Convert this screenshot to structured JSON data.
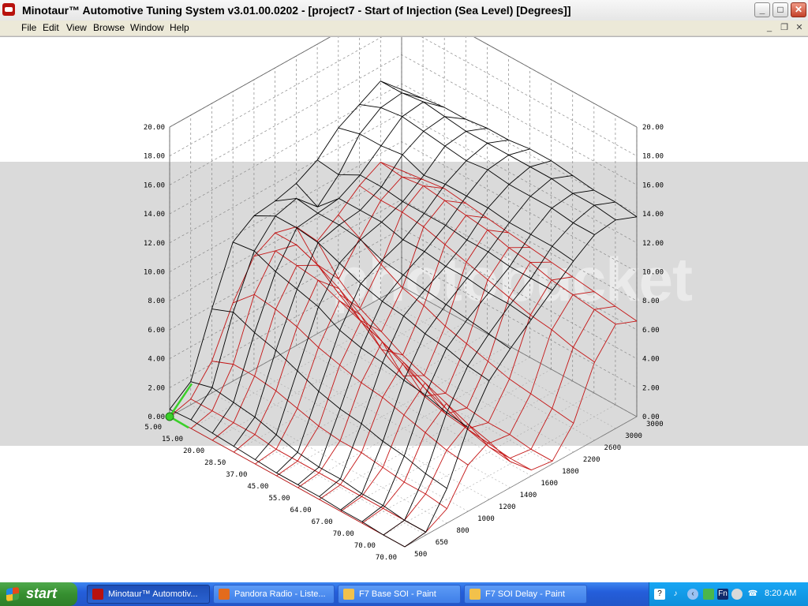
{
  "window": {
    "title": "Minotaur™ Automotive Tuning System  v3.01.00.0202 - [project7 - Start of Injection (Sea Level) [Degrees]]",
    "controls": {
      "minimize": "_",
      "maximize": "□",
      "close": "✕"
    }
  },
  "menubar": {
    "items": [
      "File",
      "Edit",
      "View",
      "Browse",
      "Window",
      "Help"
    ],
    "mdi_controls": {
      "minimize": "_",
      "restore": "❐",
      "close": "✕"
    }
  },
  "watermark": {
    "text": "photobucket"
  },
  "chart_data": {
    "type": "surface-3d",
    "axes": {
      "z_ticks": [
        "0.00",
        "2.00",
        "4.00",
        "6.00",
        "8.00",
        "10.00",
        "12.00",
        "14.00",
        "16.00",
        "18.00",
        "20.00"
      ],
      "load_ticks": [
        "5.00",
        "15.00",
        "20.00",
        "28.50",
        "37.00",
        "45.00",
        "55.00",
        "64.00",
        "67.00",
        "70.00",
        "70.00",
        "70.00"
      ],
      "rpm_ticks": [
        "500",
        "650",
        "800",
        "1000",
        "1200",
        "1400",
        "1600",
        "1800",
        "2200",
        "2600",
        "3000",
        "3000"
      ]
    },
    "series": [
      {
        "color": "#000000",
        "rows": [
          [
            0.5,
            1.6,
            5.8,
            9.6,
            10.6,
            10.8,
            11.2,
            12.0,
            13.4,
            14.2,
            15.0,
            13.6
          ],
          [
            0.6,
            2.0,
            6.4,
            9.8,
            11.4,
            11.8,
            10.4,
            11.8,
            13.8,
            14.8,
            15.0,
            13.8
          ],
          [
            0.5,
            1.8,
            5.8,
            9.2,
            11.4,
            11.6,
            11.8,
            12.6,
            13.8,
            15.0,
            15.2,
            14.0
          ],
          [
            0.4,
            1.6,
            5.4,
            8.8,
            11.2,
            11.6,
            11.8,
            12.6,
            14.0,
            14.8,
            15.0,
            14.0
          ],
          [
            0.3,
            1.2,
            4.8,
            8.4,
            10.6,
            11.4,
            11.8,
            12.4,
            13.4,
            14.6,
            14.8,
            14.2
          ],
          [
            0.2,
            0.8,
            4.2,
            7.6,
            10.0,
            10.8,
            11.4,
            12.4,
            13.6,
            14.4,
            14.8,
            14.2
          ],
          [
            0.2,
            0.6,
            3.8,
            7.2,
            9.6,
            10.6,
            11.4,
            12.4,
            13.6,
            14.6,
            14.8,
            14.4
          ],
          [
            0.2,
            0.6,
            3.6,
            7.0,
            9.4,
            10.4,
            11.2,
            12.2,
            13.6,
            14.4,
            14.8,
            14.4
          ],
          [
            0.1,
            0.4,
            3.2,
            6.6,
            9.0,
            10.2,
            11.2,
            12.2,
            13.4,
            14.4,
            14.8,
            14.2
          ],
          [
            0.1,
            0.4,
            3.0,
            6.4,
            8.8,
            10.0,
            11.0,
            12.0,
            13.4,
            14.4,
            14.6,
            14.0
          ],
          [
            0.0,
            0.2,
            2.6,
            6.0,
            8.4,
            9.8,
            11.0,
            12.0,
            13.4,
            14.2,
            14.6,
            14.0
          ],
          [
            0.0,
            0.2,
            2.4,
            5.8,
            8.2,
            9.6,
            10.8,
            12.0,
            13.2,
            14.2,
            14.4,
            13.8
          ]
        ]
      },
      {
        "color": "#c41414",
        "rows": [
          [
            0.0,
            0.4,
            2.2,
            5.4,
            7.8,
            8.6,
            8.2,
            6.4,
            7.4,
            8.6,
            9.4,
            8.0
          ],
          [
            0.0,
            0.4,
            2.8,
            6.8,
            9.0,
            8.6,
            6.4,
            4.6,
            6.6,
            8.4,
            9.2,
            8.2
          ],
          [
            0.0,
            0.4,
            2.8,
            6.6,
            8.8,
            8.0,
            5.2,
            3.4,
            5.6,
            8.4,
            9.4,
            8.4
          ],
          [
            0.0,
            0.4,
            2.6,
            6.2,
            8.6,
            7.2,
            4.2,
            2.6,
            4.8,
            8.2,
            9.2,
            8.2
          ],
          [
            0.0,
            0.2,
            2.2,
            5.6,
            8.0,
            6.2,
            3.0,
            1.8,
            4.4,
            7.8,
            9.0,
            8.0
          ],
          [
            0.0,
            0.2,
            1.8,
            5.2,
            7.4,
            5.2,
            2.0,
            1.2,
            3.8,
            7.4,
            8.8,
            7.8
          ],
          [
            0.0,
            0.2,
            1.6,
            4.8,
            6.8,
            4.4,
            1.4,
            0.8,
            3.4,
            7.0,
            8.4,
            7.6
          ],
          [
            0.0,
            0.2,
            1.6,
            4.6,
            6.2,
            3.6,
            1.0,
            0.6,
            3.0,
            6.6,
            8.2,
            7.4
          ],
          [
            0.0,
            0.2,
            1.4,
            4.2,
            5.6,
            3.0,
            0.8,
            0.4,
            2.6,
            6.2,
            7.8,
            7.2
          ],
          [
            0.0,
            0.2,
            1.2,
            3.8,
            5.0,
            2.4,
            0.6,
            0.4,
            2.4,
            6.0,
            7.6,
            7.0
          ],
          [
            0.0,
            0.2,
            1.2,
            3.4,
            4.4,
            2.0,
            0.4,
            0.2,
            2.2,
            5.6,
            7.4,
            6.8
          ],
          [
            0.0,
            0.2,
            1.0,
            3.2,
            4.0,
            1.8,
            0.4,
            0.2,
            2.0,
            5.4,
            7.2,
            6.6
          ]
        ]
      }
    ]
  },
  "taskbar": {
    "start_label": "start",
    "tasks": [
      {
        "label": "Minotaur™ Automotiv...",
        "icon_color": "#b8120f",
        "active": true
      },
      {
        "label": "Pandora Radio - Liste...",
        "icon_color": "#e36b1c",
        "active": false
      },
      {
        "label": "F7 Base SOI - Paint",
        "icon_color": "#f2c14b",
        "active": false
      },
      {
        "label": "F7 SOI Delay - Paint",
        "icon_color": "#f2c14b",
        "active": false
      }
    ],
    "tray_icons": [
      "help-icon",
      "speaker-icon",
      "back-icon",
      "network-icon",
      "fn-icon",
      "security-icon",
      "connection-icon"
    ],
    "clock": "8:20 AM"
  }
}
